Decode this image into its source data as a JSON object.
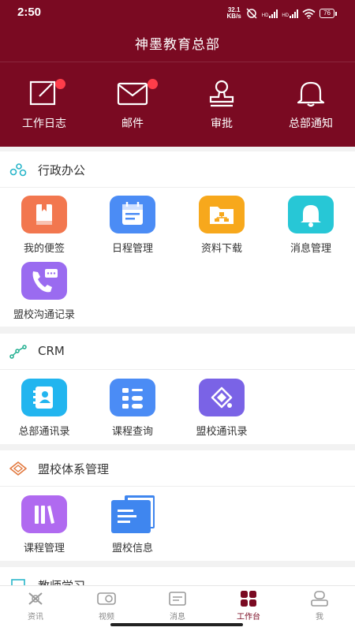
{
  "status_bar": {
    "time": "2:50",
    "net_speed": "32.1",
    "net_unit": "KB/s",
    "network": "HD",
    "battery": "76"
  },
  "header": {
    "title": "神墨教育总部"
  },
  "quick_actions": [
    {
      "label": "工作日志",
      "icon": "work-log-icon",
      "badge": true
    },
    {
      "label": "邮件",
      "icon": "mail-icon",
      "badge": true
    },
    {
      "label": "审批",
      "icon": "approval-stamp-icon",
      "badge": false
    },
    {
      "label": "总部通知",
      "icon": "bell-icon",
      "badge": false
    }
  ],
  "sections": [
    {
      "title": "行政办公",
      "icon": "admin-office-icon",
      "items": [
        {
          "label": "我的便签",
          "icon": "notepad-icon",
          "color": "#f2774f"
        },
        {
          "label": "日程管理",
          "icon": "calendar-icon",
          "color": "#4b8cf5"
        },
        {
          "label": "资料下载",
          "icon": "folder-download-icon",
          "color": "#f7a81c"
        },
        {
          "label": "消息管理",
          "icon": "bell-icon",
          "color": "#27c7d6"
        },
        {
          "label": "盟校沟通记录",
          "icon": "phone-chat-icon",
          "color": "#9a6bf0"
        }
      ]
    },
    {
      "title": "CRM",
      "icon": "crm-icon",
      "items": [
        {
          "label": "总部通讯录",
          "icon": "contacts-icon",
          "color": "#22b5ef"
        },
        {
          "label": "课程查询",
          "icon": "course-search-icon",
          "color": "#4b8cf5"
        },
        {
          "label": "盟校通讯录",
          "icon": "league-contacts-icon",
          "color": "#7a63e6"
        }
      ]
    },
    {
      "title": "盟校体系管理",
      "icon": "league-system-icon",
      "items": [
        {
          "label": "课程管理",
          "icon": "books-icon",
          "color": "#b06af0"
        },
        {
          "label": "盟校信息",
          "icon": "documents-icon",
          "color": "#3f86ef"
        }
      ]
    },
    {
      "title": "教师学习",
      "icon": "teacher-study-icon",
      "items": []
    }
  ],
  "tabs": [
    {
      "label": "资讯",
      "icon": "news-icon",
      "active": false
    },
    {
      "label": "视频",
      "icon": "video-icon",
      "active": false
    },
    {
      "label": "消息",
      "icon": "message-icon",
      "active": false
    },
    {
      "label": "工作台",
      "icon": "workbench-icon",
      "active": true
    },
    {
      "label": "我",
      "icon": "profile-icon",
      "active": false
    }
  ],
  "colors": {
    "brand": "#7a0a22",
    "badge": "#ff3d4a"
  }
}
